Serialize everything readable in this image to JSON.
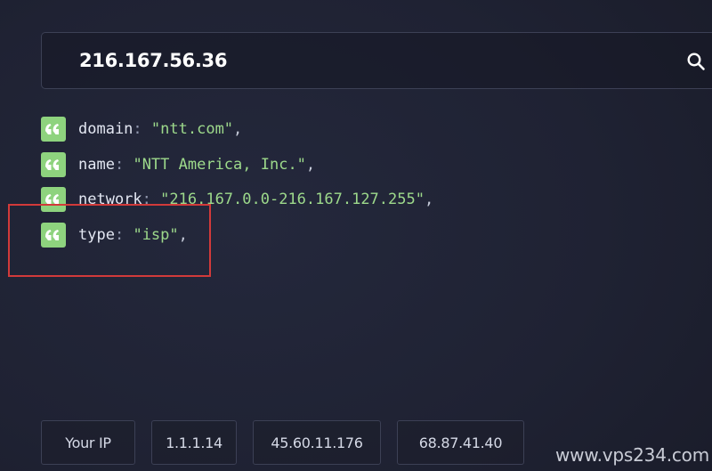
{
  "search": {
    "value": "216.167.56.36"
  },
  "results": [
    {
      "key": "domain",
      "value": "\"ntt.com\"",
      "trail": ","
    },
    {
      "key": "name",
      "value": "\"NTT America, Inc.\"",
      "trail": ","
    },
    {
      "key": "network",
      "value": "\"216.167.0.0-216.167.127.255\"",
      "trail": ","
    },
    {
      "key": "type",
      "value": "\"isp\"",
      "trail": ","
    }
  ],
  "quick_lookups": [
    "Your IP",
    "1.1.1.14",
    "45.60.11.176",
    "68.87.41.40"
  ],
  "watermark": "www.vps234.com",
  "colors": {
    "background": "#1f2233",
    "badge": "#8ed37e",
    "value_text": "#9dd98b",
    "highlight": "#d23a3a"
  },
  "icons": {
    "search": "search-icon",
    "quote": "quote-icon"
  }
}
